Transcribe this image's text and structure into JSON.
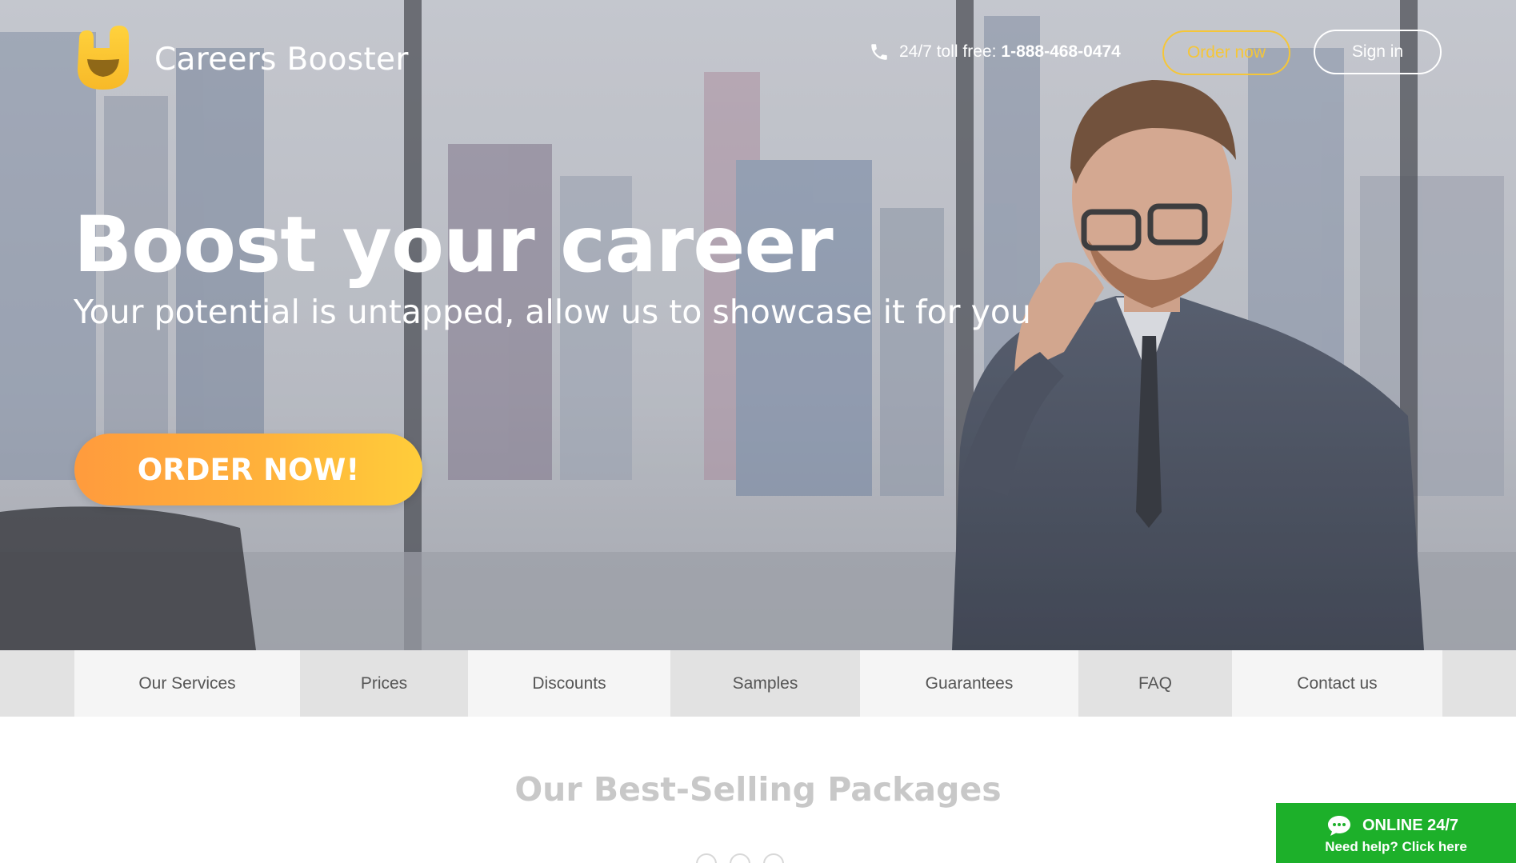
{
  "brand": {
    "name": "Careers Booster",
    "accent": "#f5c638"
  },
  "header": {
    "phone_label": "24/7 toll free:",
    "phone_number": "1-888-468-0474",
    "order_label": "Order now",
    "signin_label": "Sign in"
  },
  "hero": {
    "title": "Boost your career",
    "subtitle": "Your potential is untapped, allow us to showcase it for you",
    "cta_label": "ORDER NOW!",
    "cta_colors": [
      "#ff9b3d",
      "#ffcd3a"
    ]
  },
  "nav": {
    "items": [
      {
        "label": "Our Services"
      },
      {
        "label": "Prices"
      },
      {
        "label": "Discounts"
      },
      {
        "label": "Samples"
      },
      {
        "label": "Guarantees"
      },
      {
        "label": "FAQ"
      },
      {
        "label": "Contact us"
      }
    ]
  },
  "section": {
    "title": "Our Best-Selling Packages"
  },
  "chat": {
    "title": "ONLINE 24/7",
    "subtitle": "Need help? Click here",
    "color": "#1db02a"
  },
  "icons": [
    "logo-icon",
    "phone-icon",
    "chat-bubble-icon"
  ]
}
